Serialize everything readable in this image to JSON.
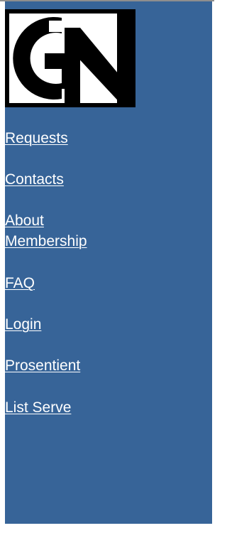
{
  "logo": {
    "text": "GN",
    "icon": "gn-logo"
  },
  "nav": {
    "items": [
      {
        "label": "Requests"
      },
      {
        "label": "Contacts"
      },
      {
        "label_line1": "About",
        "label_line2": "Membership"
      },
      {
        "label": "FAQ"
      },
      {
        "label": "Login"
      },
      {
        "label": "Prosentient"
      },
      {
        "label": "List Serve"
      }
    ]
  },
  "colors": {
    "sidebar_background": "#376498",
    "link": "#ffffff",
    "logo_black": "#000000",
    "logo_white": "#ffffff"
  }
}
